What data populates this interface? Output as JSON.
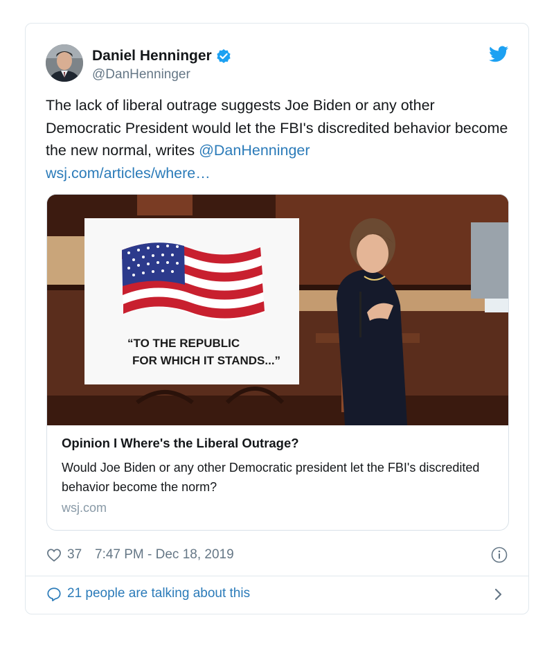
{
  "colors": {
    "link": "#2b7bb9",
    "muted": "#657786",
    "verified": "#1da1f2",
    "twitter_brand": "#1da1f2",
    "border": "#e1e8ed"
  },
  "author": {
    "name": "Daniel Henninger",
    "handle": "@DanHenninger",
    "verified_icon": "verified-badge-icon",
    "platform_icon": "twitter-bird-icon"
  },
  "tweet": {
    "text_plain": "The lack of liberal outrage suggests Joe Biden or any other Democratic President would let the FBI's discredited behavior become the new normal, writes",
    "mention": "@DanHenninger",
    "url": "wsj.com/articles/where…"
  },
  "card": {
    "image_sign_line1": "“TO THE REPUBLIC",
    "image_sign_line2": "FOR WHICH IT STANDS...”",
    "title": "Opinion I Where's the Liberal Outrage?",
    "description": "Would Joe Biden or any other Democratic president let the FBI's discredited behavior become the norm?",
    "domain": "wsj.com"
  },
  "meta": {
    "likes": "37",
    "timestamp": "7:47 PM - Dec 18, 2019",
    "info_icon": "info-icon",
    "like_icon": "heart-icon"
  },
  "footer": {
    "talking": "21 people are talking about this",
    "bubble_icon": "speech-bubble-icon",
    "chevron_icon": "chevron-right-icon"
  }
}
